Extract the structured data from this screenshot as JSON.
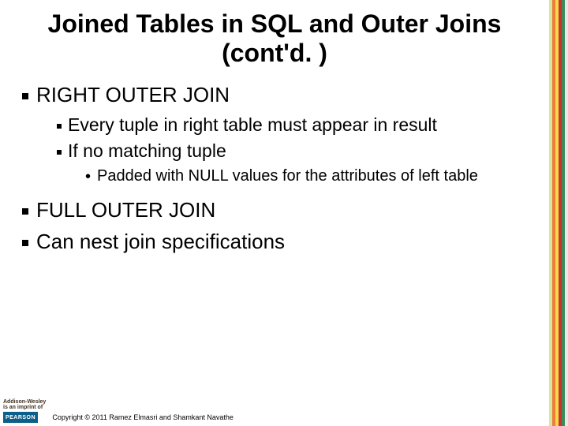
{
  "title": "Joined Tables in SQL and Outer Joins (cont'd. )",
  "sections": [
    {
      "heading": "RIGHT OUTER JOIN",
      "sub": [
        "Every tuple in right table must appear in result",
        "If no matching tuple"
      ],
      "subsub": [
        "Padded with NULL values for the attributes of left table"
      ]
    },
    {
      "heading": "FULL OUTER JOIN"
    },
    {
      "heading": "Can nest join specifications"
    }
  ],
  "footer": {
    "publisher_line1": "Addison-Wesley",
    "publisher_line2": "is an imprint of",
    "logo": "PEARSON",
    "copyright": "Copyright © 2011 Ramez Elmasri and Shamkant Navathe"
  }
}
